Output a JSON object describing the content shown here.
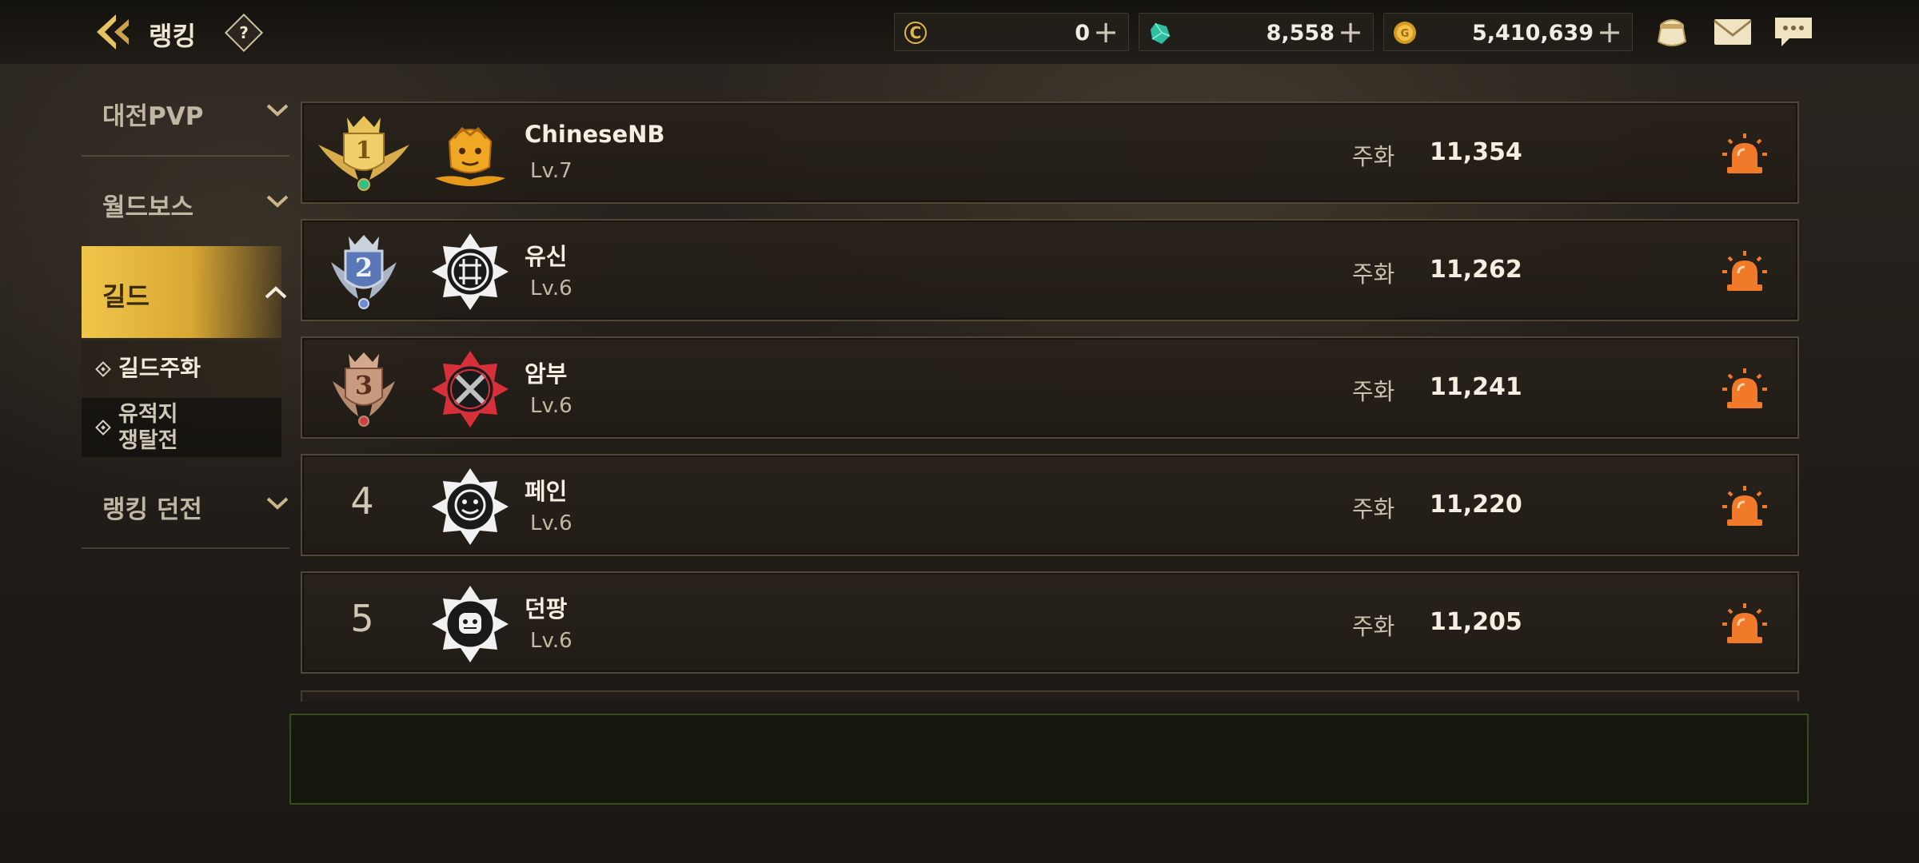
{
  "header": {
    "title": "랭킹",
    "help_label": "?",
    "currencies": [
      {
        "icon": "c-coin-icon",
        "value": "0"
      },
      {
        "icon": "green-gem-icon",
        "value": "8,558"
      },
      {
        "icon": "gold-coin-icon",
        "value": "5,410,639"
      }
    ],
    "plus_label": "+",
    "icons": [
      "pouch-icon",
      "mail-icon",
      "chat-icon"
    ]
  },
  "sidebar": {
    "categories": [
      {
        "label": "대전PVP",
        "expanded": false
      },
      {
        "label": "월드보스",
        "expanded": false
      },
      {
        "label": "길드",
        "expanded": true,
        "selected": true
      },
      {
        "label": "랭킹 던전",
        "expanded": false
      }
    ],
    "guild_subitems": [
      {
        "label": "길드주화",
        "selected": true
      },
      {
        "label": "유적지\n쟁탈전",
        "selected": false
      }
    ]
  },
  "ranking": {
    "stat_label": "주화",
    "rows": [
      {
        "rank": "1",
        "name": "ChineseNB",
        "level": "Lv.7",
        "value": "11,354",
        "badge": "gold"
      },
      {
        "rank": "2",
        "name": "유신",
        "level": "Lv.6",
        "value": "11,262",
        "badge": "silver"
      },
      {
        "rank": "3",
        "name": "암부",
        "level": "Lv.6",
        "value": "11,241",
        "badge": "bronze"
      },
      {
        "rank": "4",
        "name": "페인",
        "level": "Lv.6",
        "value": "11,220",
        "badge": "number"
      },
      {
        "rank": "5",
        "name": "던팡",
        "level": "Lv.6",
        "value": "11,205",
        "badge": "number"
      }
    ]
  },
  "colors": {
    "accent_gold": "#e8b63e",
    "report_orange": "#f07a2a",
    "panel_border_green": "#46601e"
  }
}
